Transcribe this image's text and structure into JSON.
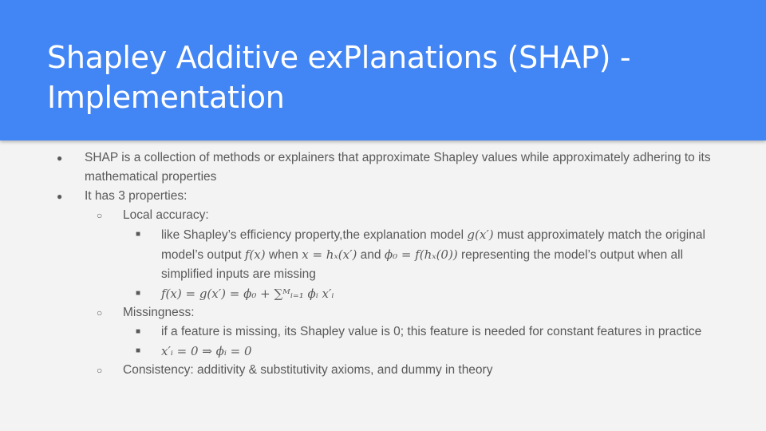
{
  "slide": {
    "title": "Shapley Additive exPlanations (SHAP) - Implementation",
    "bullets": [
      {
        "level": 1,
        "marker": "●",
        "text": "SHAP is a collection of methods or explainers that approximate Shapley values while approximately adhering to its mathematical properties"
      },
      {
        "level": 1,
        "marker": "●",
        "text": "It has 3 properties:"
      },
      {
        "level": 2,
        "marker": "○",
        "text": "Local accuracy:"
      },
      {
        "level": 3,
        "marker": "■",
        "parts": {
          "p1": "like Shapley’s efficiency property,the explanation model ",
          "m1": "g(x′)",
          "p2": " must approximately match the original model’s output ",
          "m2": "f(x)",
          "p3": " when ",
          "m3": "x = hₓ(x′)",
          "p4": " and ",
          "m4": "ϕ₀ = f(hₓ(0))",
          "p5": " representing the model’s output when all simplified inputs are missing"
        }
      },
      {
        "level": 3,
        "marker": "■",
        "math": "f(x) = g(x′) = ϕ₀ + ∑ᴹᵢ₌₁ ϕᵢ x′ᵢ"
      },
      {
        "level": 2,
        "marker": "○",
        "text": "Missingness:"
      },
      {
        "level": 3,
        "marker": "■",
        "text": "if a feature is missing, its Shapley value is 0; this feature is needed for constant features in practice"
      },
      {
        "level": 3,
        "marker": "■",
        "math": "x′ᵢ = 0 ⇒ ϕᵢ = 0"
      },
      {
        "level": 2,
        "marker": "○",
        "text": "Consistency: additivity & substitutivity axioms, and dummy in theory"
      }
    ]
  },
  "colors": {
    "header_bg": "#4285f4",
    "title_text": "#ffffff",
    "body_bg": "#f3f3f3",
    "body_text": "#595959"
  }
}
